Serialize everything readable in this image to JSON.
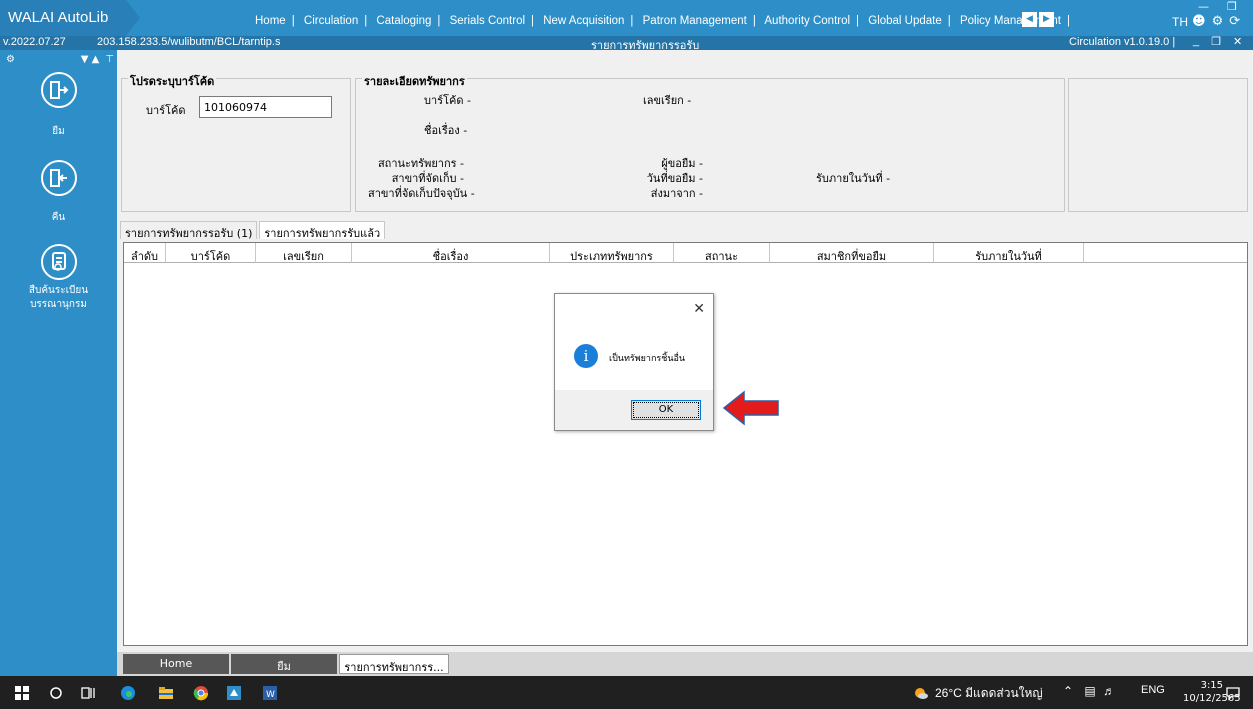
{
  "app": {
    "brand": "WALAI AutoLib",
    "nav": [
      "Home",
      "Circulation",
      "Cataloging",
      "Serials Control",
      "New Acquisition",
      "Patron Management",
      "Authority Control",
      "Global Update",
      "Policy Management"
    ],
    "lang": "TH"
  },
  "infobar": {
    "version": "v.2022.07.27",
    "path": "203.158.233.5/wulibutm/BCL/tarntip.s",
    "screen_title": "รายการทรัพยากรรอรับ",
    "module": "Circulation v1.0.19.0 |"
  },
  "sidebar": {
    "items": [
      {
        "label": "ยืม"
      },
      {
        "label": "คืน"
      },
      {
        "label": "สืบค้นระเบียน บรรณานุกรม"
      }
    ]
  },
  "barcode_panel": {
    "title": "โปรดระบุบาร์โค้ด",
    "label": "บาร์โค้ด",
    "value": "101060974"
  },
  "detail_panel": {
    "title": "รายละเอียดทรัพยากร",
    "barcode": "บาร์โค้ด  -",
    "call_no": "เลขเรียก  -",
    "title_lbl": "ชื่อเรื่อง  -",
    "status": "สถานะทรัพยากร  -",
    "branch": "สาขาที่จัดเก็บ  -",
    "current_branch": "สาขาที่จัดเก็บปัจจุบัน  -",
    "borrower": "ผู้ขอยืม  -",
    "request_date": "วันที่ขอยืม  -",
    "sent_from": "ส่งมาจาก  -",
    "pickup_by": "รับภายในวันที่  -"
  },
  "tabs": [
    "รายการทรัพยากรรอรับ (1)",
    "รายการทรัพยากรรับแล้ว"
  ],
  "grid": {
    "columns": [
      "ลำดับ",
      "บาร์โค้ด",
      "เลขเรียก",
      "ชื่อเรื่อง",
      "ประเภททรัพยากร",
      "สถานะ",
      "สมาชิกที่ขอยืม",
      "รับภายในวันที่"
    ]
  },
  "dialog": {
    "message": "เป็นทรัพยากรชิ้นอื่น",
    "ok_label": "OK"
  },
  "bottom_tabs": [
    "Home",
    "ยืม",
    "รายการทรัพยากรร..."
  ],
  "taskbar": {
    "weather": "26°C  มีแดดส่วนใหญ่",
    "lang": "ENG",
    "time": "3:15",
    "date": "10/12/2565"
  },
  "colors": {
    "nav_bg": "#2e8fc8",
    "accent_red": "#e31b1b",
    "info_blue": "#1a7fd9"
  }
}
